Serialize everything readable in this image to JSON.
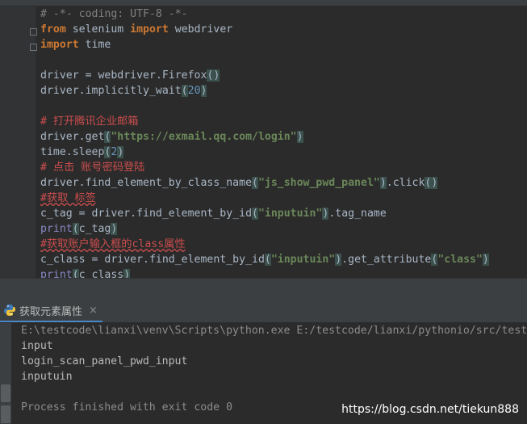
{
  "editor": {
    "lines": [
      [
        {
          "t": "# -*- coding: UTF-8 -*-",
          "c": "c-cm"
        }
      ],
      [
        {
          "t": "from",
          "c": "c-kw"
        },
        {
          "t": " selenium ",
          "c": "c-id"
        },
        {
          "t": "import",
          "c": "c-kw"
        },
        {
          "t": " webdriver",
          "c": "c-id"
        }
      ],
      [
        {
          "t": "import",
          "c": "c-kw"
        },
        {
          "t": " time",
          "c": "c-id"
        }
      ],
      [],
      [
        {
          "t": "driver = webdriver.Firefox",
          "c": "c-id"
        },
        {
          "t": "()",
          "c": "c-p c-hl"
        }
      ],
      [
        {
          "t": "driver.implicitly_wait",
          "c": "c-id"
        },
        {
          "t": "(",
          "c": "c-p c-hl"
        },
        {
          "t": "20",
          "c": "c-num"
        },
        {
          "t": ")",
          "c": "c-p c-hl"
        }
      ],
      [],
      [
        {
          "t": "# 打开腾讯企业邮箱",
          "c": "c-cm-cn"
        }
      ],
      [
        {
          "t": "driver.get",
          "c": "c-id"
        },
        {
          "t": "(",
          "c": "c-p c-hl"
        },
        {
          "t": "\"https://exmail.qq.com/login\"",
          "c": "c-str"
        },
        {
          "t": ")",
          "c": "c-p c-hl"
        }
      ],
      [
        {
          "t": "time.sleep",
          "c": "c-id"
        },
        {
          "t": "(",
          "c": "c-p c-hl"
        },
        {
          "t": "2",
          "c": "c-num"
        },
        {
          "t": ")",
          "c": "c-p c-hl"
        }
      ],
      [
        {
          "t": "# 点击 账号密码登陆",
          "c": "c-cm-cn"
        }
      ],
      [
        {
          "t": "driver.find_element_by_class_name",
          "c": "c-id"
        },
        {
          "t": "(",
          "c": "c-p c-hl"
        },
        {
          "t": "\"js_show_pwd_panel\"",
          "c": "c-str"
        },
        {
          "t": ")",
          "c": "c-p c-hl"
        },
        {
          "t": ".click",
          "c": "c-id"
        },
        {
          "t": "()",
          "c": "c-p c-hl"
        }
      ],
      [
        {
          "t": "#获取 标签",
          "c": "c-cm-cn squig"
        }
      ],
      [
        {
          "t": "c_tag = driver.find_element_by_id",
          "c": "c-id"
        },
        {
          "t": "(",
          "c": "c-p c-hl"
        },
        {
          "t": "\"inputuin\"",
          "c": "c-str"
        },
        {
          "t": ")",
          "c": "c-p c-hl"
        },
        {
          "t": ".tag_name",
          "c": "c-id"
        }
      ],
      [
        {
          "t": "print",
          "c": "c-bi"
        },
        {
          "t": "(",
          "c": "c-p c-hl"
        },
        {
          "t": "c_tag",
          "c": "c-id"
        },
        {
          "t": ")",
          "c": "c-p c-hl"
        }
      ],
      [
        {
          "t": "#获取账户输入框的class属性",
          "c": "c-cm-cn squig"
        }
      ],
      [
        {
          "t": "c_class = driver.find_element_by_id",
          "c": "c-id"
        },
        {
          "t": "(",
          "c": "c-p c-hl"
        },
        {
          "t": "\"inputuin\"",
          "c": "c-str"
        },
        {
          "t": ")",
          "c": "c-p c-hl"
        },
        {
          "t": ".get_attribute",
          "c": "c-id"
        },
        {
          "t": "(",
          "c": "c-p c-hl"
        },
        {
          "t": "\"class\"",
          "c": "c-str"
        },
        {
          "t": ")",
          "c": "c-p c-hl"
        }
      ],
      [
        {
          "t": "print",
          "c": "c-bi"
        },
        {
          "t": "(",
          "c": "c-p c-hl"
        },
        {
          "t": "c_class",
          "c": "c-id"
        },
        {
          "t": ")",
          "c": "c-p c-hl"
        }
      ]
    ]
  },
  "run_panel": {
    "tab_label": "获取元素属性",
    "close_glyph": "×",
    "icon": "python-icon"
  },
  "console": {
    "command": "E:\\testcode\\lianxi\\venv\\Scripts\\python.exe E:/testcode/lianxi/pythonio/src/test",
    "output": [
      "input",
      "login_scan_panel_pwd_input",
      "inputuin"
    ],
    "finish": "Process finished with exit code 0"
  },
  "watermark": "https://blog.csdn.net/tiekun888"
}
